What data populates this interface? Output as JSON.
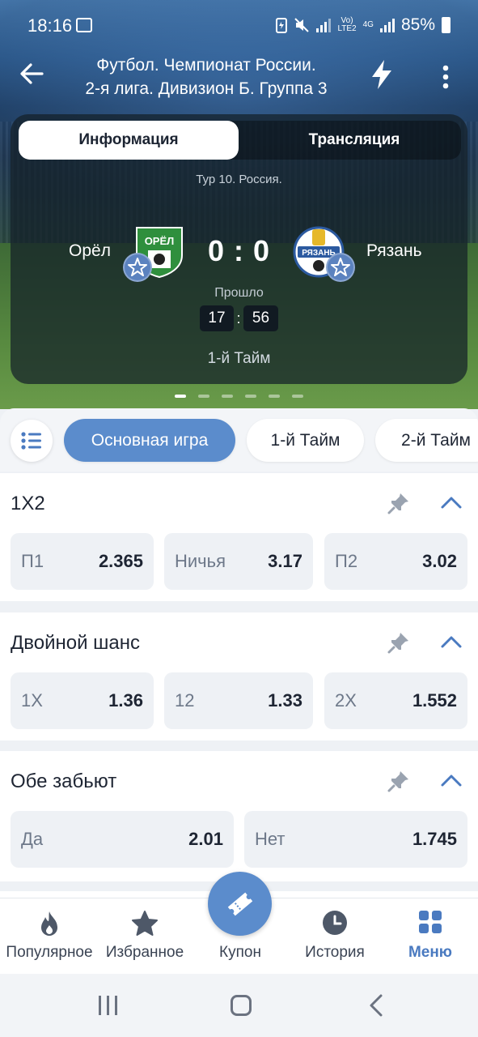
{
  "status": {
    "time": "18:16",
    "network_top": "Vo)",
    "network_bottom": "LTE2",
    "network_gen": "4G",
    "battery": "85%"
  },
  "header": {
    "title_line1": "Футбол. Чемпионат России.",
    "title_line2": "2-я лига. Дивизион Б. Группа 3"
  },
  "tabs": {
    "info": "Информация",
    "stream": "Трансляция"
  },
  "match": {
    "round": "Тур 10. Россия.",
    "team1": "Орёл",
    "team2": "Рязань",
    "logo1_text": "ОРЁЛ",
    "logo2_text": "РЯЗАНЬ",
    "score": "0 : 0",
    "elapsed_label": "Прошло",
    "minutes": "17",
    "seconds": "56",
    "period": "1-й Тайм"
  },
  "filters": {
    "main": "Основная игра",
    "first_half": "1-й Тайм",
    "second_half": "2-й Тайм"
  },
  "markets": {
    "m1": {
      "title": "1X2",
      "o1_label": "П1",
      "o1_value": "2.365",
      "o2_label": "Ничья",
      "o2_value": "3.17",
      "o3_label": "П2",
      "o3_value": "3.02"
    },
    "m2": {
      "title": "Двойной шанс",
      "o1_label": "1X",
      "o1_value": "1.36",
      "o2_label": "12",
      "o2_value": "1.33",
      "o3_label": "2X",
      "o3_value": "1.552"
    },
    "m3": {
      "title": "Обе забьют",
      "o1_label": "Да",
      "o1_value": "2.01",
      "o2_label": "Нет",
      "o2_value": "1.745"
    }
  },
  "nav": {
    "popular": "Популярное",
    "favorites": "Избранное",
    "coupon": "Купон",
    "history": "История",
    "menu": "Меню"
  },
  "colors": {
    "accent": "#5b8ccc",
    "menu_active": "#4a7ac0"
  }
}
